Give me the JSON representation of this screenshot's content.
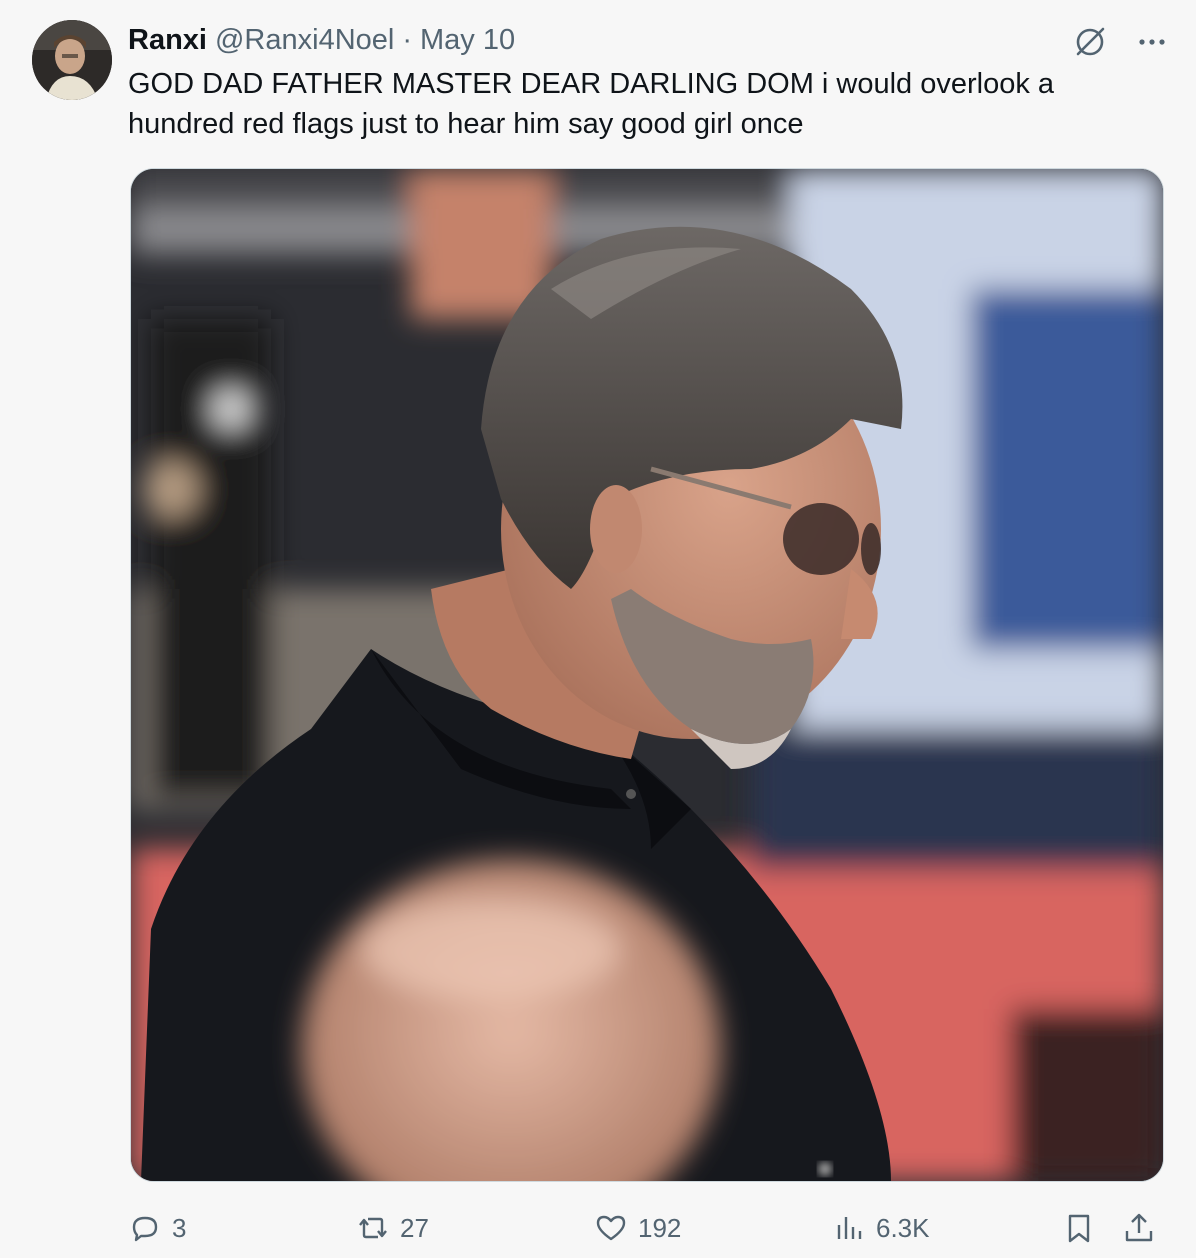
{
  "tweet": {
    "display_name": "Ranxi",
    "handle": "@Ranxi4Noel",
    "separator": "·",
    "date": "May 10",
    "text": "GOD DAD FATHER MASTER DEAR DARLING DOM i would overlook a hundred red flags just to hear him say good girl once"
  },
  "actions": {
    "replies": "3",
    "reposts": "27",
    "likes": "192",
    "views": "6.3K"
  },
  "icons": {
    "avatar": "avatar",
    "grok": "grok-icon",
    "more": "more-icon",
    "reply": "reply-icon",
    "repost": "repost-icon",
    "like": "heart-icon",
    "views": "views-icon",
    "bookmark": "bookmark-icon",
    "share": "share-icon"
  },
  "colors": {
    "background": "#f7f7f7",
    "text": "#0f1419",
    "secondary": "#536471"
  }
}
